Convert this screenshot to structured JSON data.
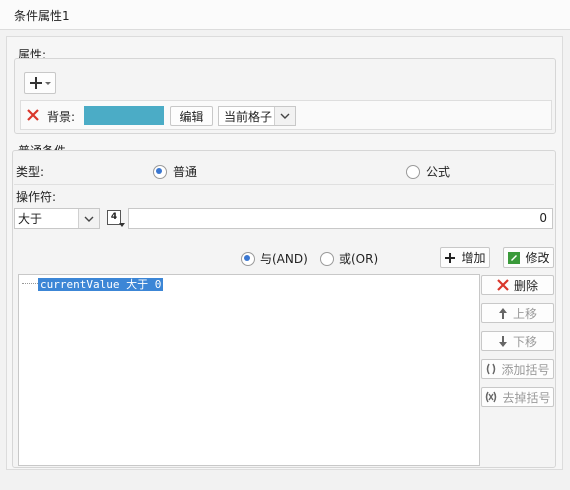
{
  "window": {
    "title": "条件属性1"
  },
  "properties": {
    "group_title": "属性:",
    "add_icon": "plus-icon",
    "row": {
      "label": "背景:",
      "color_swatch": "#4bacc6",
      "edit_button": "编辑",
      "scope_select": "当前格子"
    }
  },
  "condition": {
    "group_title": "普通条件",
    "type_label": "类型:",
    "type_options": [
      {
        "label": "普通",
        "checked": true
      },
      {
        "label": "公式",
        "checked": false
      }
    ],
    "operator_label": "操作符:",
    "operator_select": "大于",
    "value_type_icon": "4",
    "value": "0",
    "logic_options": [
      {
        "label": "与(AND)",
        "checked": true
      },
      {
        "label": "或(OR)",
        "checked": false
      }
    ],
    "add_button": "增加",
    "modify_button": "修改",
    "list_items": [
      "currentValue 大于 0"
    ],
    "side_buttons": {
      "delete": "删除",
      "move_up": "上移",
      "move_down": "下移",
      "add_bracket": "添加括号",
      "remove_bracket": "去掉括号"
    }
  }
}
